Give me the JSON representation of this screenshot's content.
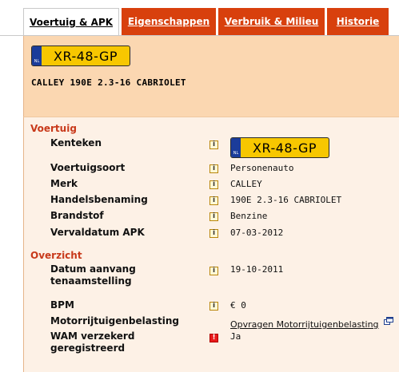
{
  "tabs": [
    {
      "label": "Voertuig & APK",
      "active": true
    },
    {
      "label": "Eigenschappen",
      "active": false
    },
    {
      "label": "Verbruik & Milieu",
      "active": false
    },
    {
      "label": "Historie",
      "active": false
    }
  ],
  "header": {
    "plate_country": "NL",
    "plate_text": "XR-48-GP",
    "vehicle_title": "CALLEY  190E 2.3-16 CABRIOLET"
  },
  "sections": {
    "voertuig": "Voertuig",
    "overzicht": "Overzicht"
  },
  "rows": {
    "kenteken": {
      "label": "Kenteken",
      "plate_country": "NL",
      "plate_text": "XR-48-GP"
    },
    "voertuigsoort": {
      "label": "Voertuigsoort",
      "value": "Personenauto"
    },
    "merk": {
      "label": "Merk",
      "value": "CALLEY"
    },
    "handelsbenaming": {
      "label": "Handelsbenaming",
      "value": "190E 2.3-16 CABRIOLET"
    },
    "brandstof": {
      "label": "Brandstof",
      "value": "Benzine"
    },
    "vervaldatum": {
      "label": "Vervaldatum APK",
      "value": "07-03-2012"
    },
    "datum_aanvang": {
      "label_line1": "Datum aanvang",
      "label_line2": "tenaamstelling",
      "value": "19-10-2011"
    },
    "bpm": {
      "label": "BPM",
      "value": "€ 0"
    },
    "mrb": {
      "label": "Motorrijtuigenbelasting",
      "link": "Opvragen Motorrijtuigenbelasting"
    },
    "wam": {
      "label_line1": "WAM verzekerd",
      "label_line2": "geregistreerd",
      "value": "Ja"
    }
  },
  "icons": {
    "info_glyph": "i",
    "warning_glyph": "!"
  },
  "colors": {
    "tab_active_bg": "#ffffff",
    "tab_inactive_bg": "#d8400d",
    "header_bg": "#fbd7b1",
    "body_bg": "#fdf1e6",
    "section_title": "#c8391a",
    "plate_yellow": "#f7c700",
    "plate_eu_blue": "#1b3c9a",
    "warning_red": "#e81b1b"
  }
}
